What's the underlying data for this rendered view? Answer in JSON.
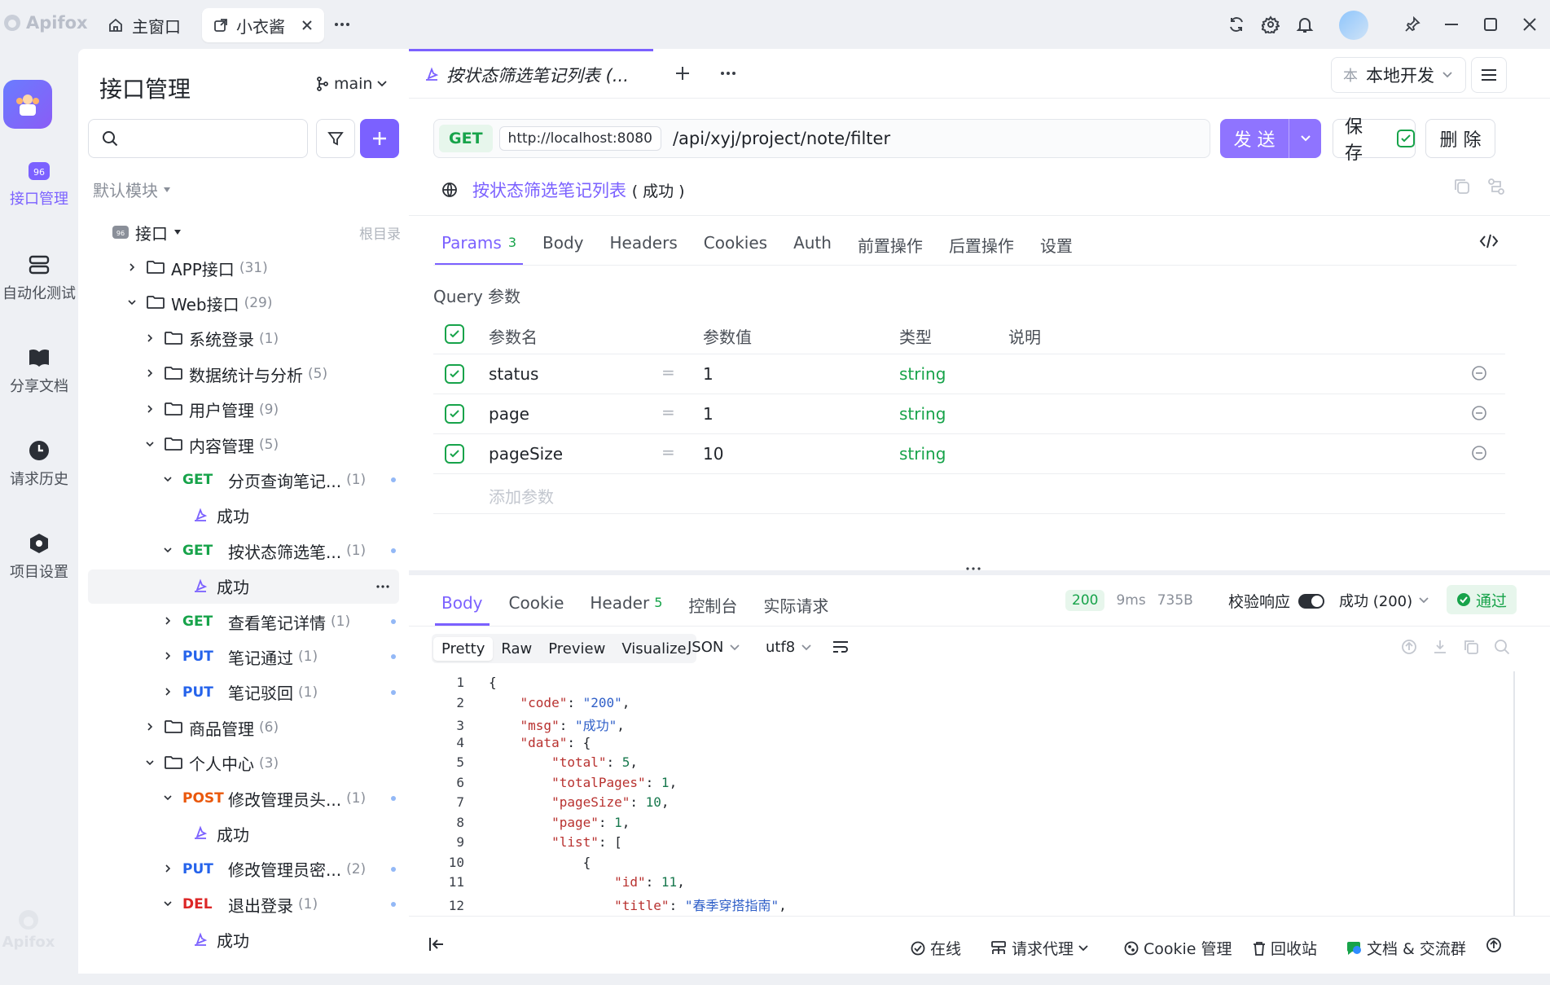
{
  "titlebar": {
    "brand": "Apifox",
    "tabs": [
      {
        "label": "主窗口"
      },
      {
        "label": "小衣酱"
      }
    ]
  },
  "rail": {
    "items": [
      {
        "label": "接口管理"
      },
      {
        "label": "自动化测试"
      },
      {
        "label": "分享文档"
      },
      {
        "label": "请求历史"
      },
      {
        "label": "项目设置"
      }
    ],
    "footer": "Apifox"
  },
  "tree": {
    "title": "接口管理",
    "branch": "main",
    "module": "默认模块",
    "root": {
      "label": "接口",
      "hint": "根目录"
    },
    "rows": [
      {
        "type": "folder",
        "label": "APP接口",
        "count": "(31)"
      },
      {
        "type": "folder",
        "label": "Web接口",
        "count": "(29)"
      },
      {
        "type": "folder",
        "label": "系统登录",
        "count": "(1)"
      },
      {
        "type": "folder",
        "label": "数据统计与分析",
        "count": "(5)"
      },
      {
        "type": "folder",
        "label": "用户管理",
        "count": "(9)"
      },
      {
        "type": "folder",
        "label": "内容管理",
        "count": "(5)"
      },
      {
        "type": "api",
        "method": "GET",
        "label": "分页查询笔记...",
        "count": "(1)"
      },
      {
        "type": "case",
        "label": "成功"
      },
      {
        "type": "api",
        "method": "GET",
        "label": "按状态筛选笔...",
        "count": "(1)"
      },
      {
        "type": "case",
        "label": "成功"
      },
      {
        "type": "api",
        "method": "GET",
        "label": "查看笔记详情",
        "count": "(1)"
      },
      {
        "type": "api",
        "method": "PUT",
        "label": "笔记通过",
        "count": "(1)"
      },
      {
        "type": "api",
        "method": "PUT",
        "label": "笔记驳回",
        "count": "(1)"
      },
      {
        "type": "folder",
        "label": "商品管理",
        "count": "(6)"
      },
      {
        "type": "folder",
        "label": "个人中心",
        "count": "(3)"
      },
      {
        "type": "api",
        "method": "POST",
        "label": "修改管理员头...",
        "count": "(1)"
      },
      {
        "type": "case",
        "label": "成功"
      },
      {
        "type": "api",
        "method": "PUT",
        "label": "修改管理员密...",
        "count": "(2)"
      },
      {
        "type": "api",
        "method": "DEL",
        "label": "退出登录",
        "count": "(1)"
      },
      {
        "type": "case",
        "label": "成功"
      }
    ]
  },
  "editor": {
    "tab_title": "按状态筛选笔记列表 (...",
    "env": {
      "badge": "本",
      "label": "本地开发"
    },
    "method": "GET",
    "base_url": "http://localhost:8080",
    "path": "/api/xyj/project/note/filter",
    "send": "发 送",
    "save": "保 存",
    "delete": "删 除",
    "case_name": "按状态筛选笔记列表",
    "case_status": "( 成功 )",
    "req_tabs": [
      {
        "label": "Params",
        "badge": "3"
      },
      {
        "label": "Body"
      },
      {
        "label": "Headers"
      },
      {
        "label": "Cookies"
      },
      {
        "label": "Auth"
      },
      {
        "label": "前置操作"
      },
      {
        "label": "后置操作"
      },
      {
        "label": "设置"
      }
    ],
    "query_title": "Query 参数",
    "param_headers": {
      "name": "参数名",
      "value": "参数值",
      "type": "类型",
      "desc": "说明"
    },
    "params": [
      {
        "name": "status",
        "value": "1",
        "type": "string"
      },
      {
        "name": "page",
        "value": "1",
        "type": "string"
      },
      {
        "name": "pageSize",
        "value": "10",
        "type": "string"
      }
    ],
    "add_param": "添加参数"
  },
  "response": {
    "tabs": [
      {
        "label": "Body"
      },
      {
        "label": "Cookie"
      },
      {
        "label": "Header",
        "badge": "5"
      },
      {
        "label": "控制台"
      },
      {
        "label": "实际请求"
      }
    ],
    "status_code": "200",
    "time": "9ms",
    "size": "735B",
    "validate_label": "校验响应",
    "validate_select": "成功 (200)",
    "pass_label": "通过",
    "view_modes": [
      "Pretty",
      "Raw",
      "Preview",
      "Visualize"
    ],
    "format": "JSON",
    "encoding": "utf8",
    "code_lines": [
      {
        "n": "1",
        "indent": 0,
        "text": "{"
      },
      {
        "n": "2",
        "indent": 1,
        "key": "\"code\"",
        "val": "\"200\"",
        "vtype": "s",
        "tail": ","
      },
      {
        "n": "3",
        "indent": 1,
        "key": "\"msg\"",
        "val": "\"成功\"",
        "vtype": "s",
        "tail": ","
      },
      {
        "n": "4",
        "indent": 1,
        "key": "\"data\"",
        "val": "{",
        "vtype": "p",
        "tail": ""
      },
      {
        "n": "5",
        "indent": 2,
        "key": "\"total\"",
        "val": "5",
        "vtype": "n",
        "tail": ","
      },
      {
        "n": "6",
        "indent": 2,
        "key": "\"totalPages\"",
        "val": "1",
        "vtype": "n",
        "tail": ","
      },
      {
        "n": "7",
        "indent": 2,
        "key": "\"pageSize\"",
        "val": "10",
        "vtype": "n",
        "tail": ","
      },
      {
        "n": "8",
        "indent": 2,
        "key": "\"page\"",
        "val": "1",
        "vtype": "n",
        "tail": ","
      },
      {
        "n": "9",
        "indent": 2,
        "key": "\"list\"",
        "val": "[",
        "vtype": "p",
        "tail": ""
      },
      {
        "n": "10",
        "indent": 3,
        "text": "{"
      },
      {
        "n": "11",
        "indent": 4,
        "key": "\"id\"",
        "val": "11",
        "vtype": "n",
        "tail": ","
      },
      {
        "n": "12",
        "indent": 4,
        "key": "\"title\"",
        "val": "\"春季穿搭指南\"",
        "vtype": "s",
        "tail": ","
      }
    ]
  },
  "statusbar": {
    "online": "在线",
    "proxy": "请求代理",
    "cookie": "Cookie 管理",
    "recycle": "回收站",
    "docs": "文档 & 交流群"
  },
  "colors": {
    "accent": "#7b61ff",
    "get": "#17a34a",
    "put": "#2563eb",
    "post": "#ea580c",
    "del": "#dc2626"
  }
}
